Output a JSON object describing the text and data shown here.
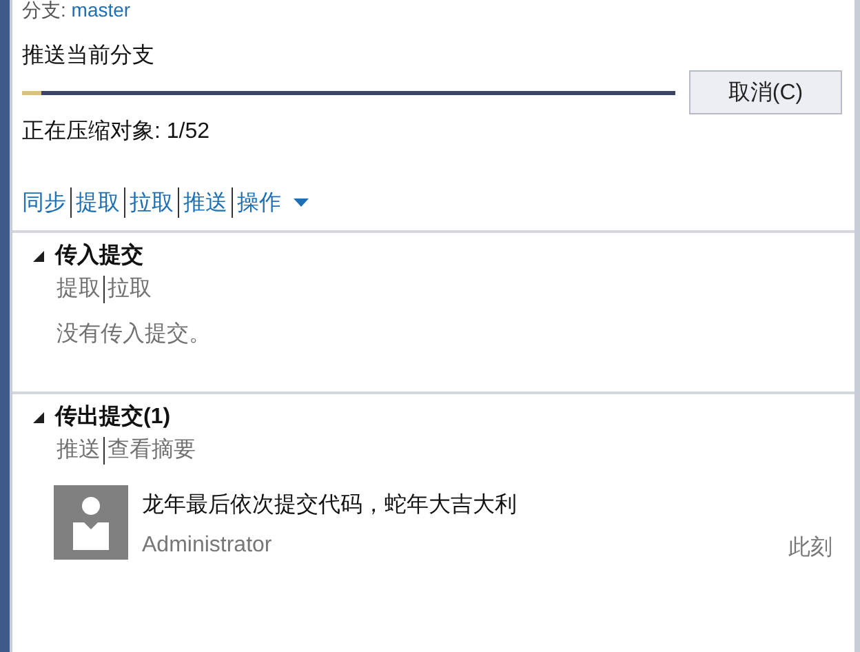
{
  "branch": {
    "label": "分支:",
    "name": "master"
  },
  "operation": {
    "title": "推送当前分支",
    "level": 0.03,
    "cancel": "取消(C)",
    "status": "正在压缩对象: 1/52"
  },
  "actions": [
    {
      "label": "同步",
      "kind": "link"
    },
    {
      "label": "提取",
      "kind": "link"
    },
    {
      "label": "拉取",
      "kind": "link"
    },
    {
      "label": "推送",
      "kind": "link"
    },
    {
      "label": "操作",
      "kind": "menu"
    }
  ],
  "sections": [
    {
      "title": "传入提交",
      "expanded": true,
      "links": [
        "提取",
        "拉取"
      ],
      "empty_text": "没有传入提交。"
    },
    {
      "title": "传出提交(1)",
      "expanded": true,
      "links": [
        "推送",
        "查看摘要"
      ],
      "commits": [
        {
          "message": "龙年最后依次提交代码，蛇年大吉大利",
          "author": "Administrator",
          "time": "此刻"
        }
      ]
    }
  ]
}
